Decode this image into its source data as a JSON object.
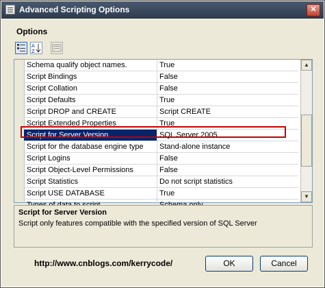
{
  "window": {
    "title": "Advanced Scripting Options"
  },
  "section_label": "Options",
  "toolbar": {
    "buttons": [
      {
        "name": "categorized-view",
        "icon": "categorized-icon"
      },
      {
        "name": "alphabetical-sort",
        "icon": "sort-az-icon"
      },
      {
        "name": "property-pages",
        "icon": "property-pages-icon"
      }
    ]
  },
  "grid": {
    "rows": [
      {
        "name": "Schema qualify object names.",
        "value": "True"
      },
      {
        "name": "Script Bindings",
        "value": "False"
      },
      {
        "name": "Script Collation",
        "value": "False"
      },
      {
        "name": "Script Defaults",
        "value": "True"
      },
      {
        "name": "Script DROP and CREATE",
        "value": "Script CREATE"
      },
      {
        "name": "Script Extended Properties",
        "value": "True"
      },
      {
        "name": "Script for Server Version",
        "value": "SQL Server 2005"
      },
      {
        "name": "Script for the database engine type",
        "value": "Stand-alone instance"
      },
      {
        "name": "Script Logins",
        "value": "False"
      },
      {
        "name": "Script Object-Level Permissions",
        "value": "False"
      },
      {
        "name": "Script Statistics",
        "value": "Do not script statistics"
      },
      {
        "name": "Script USE DATABASE",
        "value": "True"
      },
      {
        "name": "Types of data to script",
        "value": "Schema only"
      }
    ],
    "selected_index": 6
  },
  "description": {
    "title": "Script for Server Version",
    "text": "Script only features compatible with the specified version of SQL Server"
  },
  "footer": {
    "url": "http://www.cnblogs.com/kerrycode/",
    "ok_label": "OK",
    "cancel_label": "Cancel"
  },
  "colors": {
    "selection": "#0a246a",
    "highlight_box": "#c00000"
  }
}
